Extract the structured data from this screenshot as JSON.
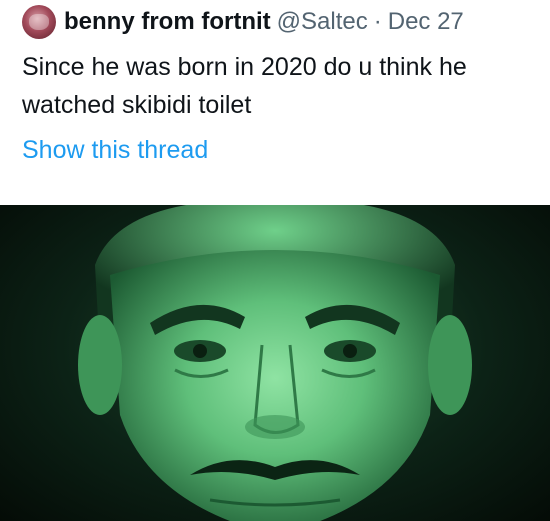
{
  "tweet": {
    "display_name": "benny from fortnit",
    "handle": "@Saltec",
    "separator": "·",
    "date": "Dec 27",
    "text": "Since he was born in 2020 do u think he watched skibidi toilet",
    "thread_link": "Show this thread"
  },
  "media": {
    "description_icon": "portrait-image",
    "colors": {
      "glow": "#9ff0b0",
      "skin": "#5fbf7a",
      "shadow": "#0b2414"
    }
  }
}
